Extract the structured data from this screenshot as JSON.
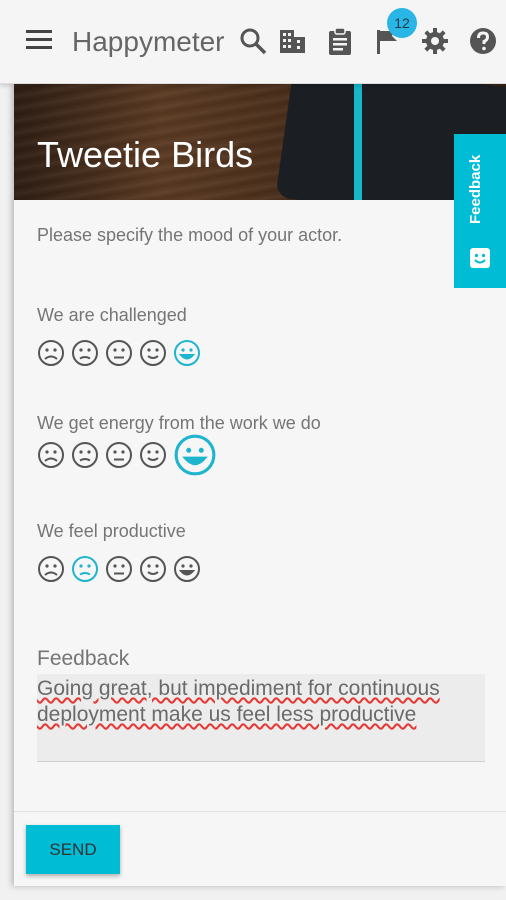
{
  "appbar": {
    "title": "Happymeter",
    "notification_count": "12",
    "icons": [
      "menu-icon",
      "search-icon",
      "building-icon",
      "clipboard-icon",
      "flag-icon",
      "gear-icon",
      "help-icon"
    ]
  },
  "team": {
    "name": "Tweetie Birds"
  },
  "prompt": "Please specify the mood of your actor.",
  "questions": [
    {
      "text": "We are challenged",
      "selected_index": 4
    },
    {
      "text": "We get energy from the work we do",
      "selected_index": 4
    },
    {
      "text": "We feel productive",
      "selected_index": 1
    }
  ],
  "moods": [
    "very-sad",
    "sad",
    "neutral",
    "happy",
    "very-happy"
  ],
  "feedback": {
    "label": "Feedback",
    "value": "Going great, but impediment for continuous deployment make us feel less productive"
  },
  "send_label": "SEND",
  "side_tab": {
    "label": "Feedback"
  },
  "colors": {
    "accent": "#00bcd4",
    "selected_face": "#1fb5cf",
    "face": "#555555",
    "badge": "#29b6e6"
  }
}
